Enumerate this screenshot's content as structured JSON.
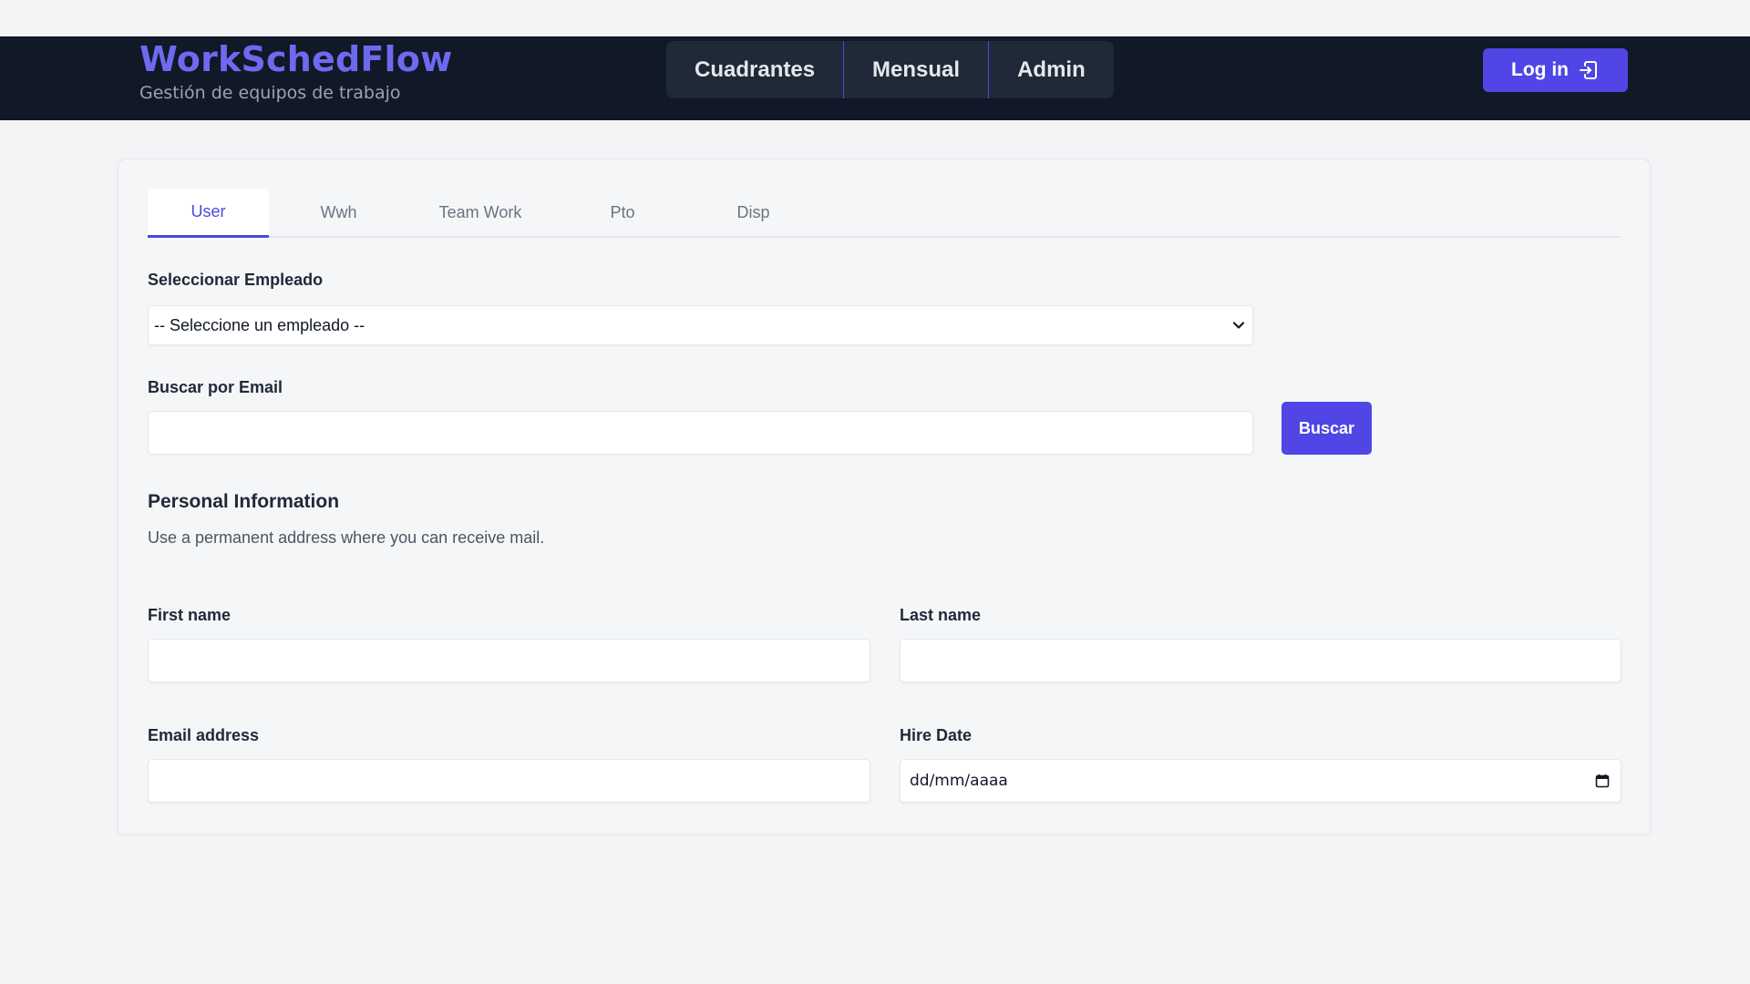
{
  "header": {
    "brand_title": "WorkSchedFlow",
    "brand_subtitle": "Gestión de equipos de trabajo",
    "nav": [
      {
        "label": "Cuadrantes"
      },
      {
        "label": "Mensual"
      },
      {
        "label": "Admin"
      }
    ],
    "login_label": "Log in",
    "login_icon": "log-in-icon"
  },
  "tabs": [
    {
      "label": "User",
      "active": true
    },
    {
      "label": "Wwh",
      "active": false
    },
    {
      "label": "Team Work",
      "active": false
    },
    {
      "label": "Pto",
      "active": false
    },
    {
      "label": "Disp",
      "active": false
    }
  ],
  "form": {
    "select_employee_label": "Seleccionar Empleado",
    "select_employee_value": "-- Seleccione un empleado --",
    "search_email_label": "Buscar por Email",
    "search_email_value": "",
    "search_button_label": "Buscar",
    "section_title": "Personal Information",
    "section_description": "Use a permanent address where you can receive mail.",
    "first_name_label": "First name",
    "first_name_value": "",
    "last_name_label": "Last name",
    "last_name_value": "",
    "email_label": "Email address",
    "email_value": "",
    "hire_date_label": "Hire Date",
    "hire_date_placeholder": "dd/mm/aaaa"
  },
  "colors": {
    "accent": "#4f46e5",
    "brand": "#6d6af0",
    "header_bg": "#111827",
    "page_bg": "#f3f4f6"
  }
}
